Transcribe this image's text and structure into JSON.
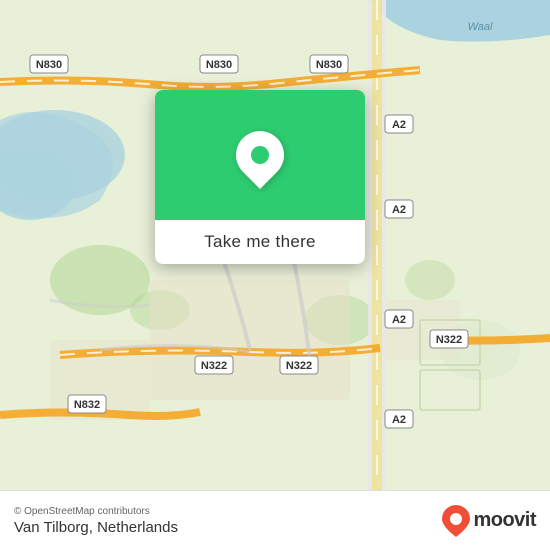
{
  "map": {
    "background_color": "#e8f0d8",
    "alt": "Map of Van Tilborg, Netherlands"
  },
  "popup": {
    "button_label": "Take me there",
    "pin_color": "#2ecc71",
    "pin_bg": "white"
  },
  "footer": {
    "credit": "© OpenStreetMap contributors",
    "location_name": "Van Tilborg, Netherlands",
    "logo_text": "moovit"
  },
  "road_labels": {
    "n830_tl": "N830",
    "n830_tr": "N830",
    "n830_tm": "N830",
    "a2_r1": "A2",
    "a2_r2": "A2",
    "a2_r3": "A2",
    "a2_bot": "A2",
    "n322_l": "N322",
    "n322_m": "N322",
    "n322_r": "N322",
    "n832": "N832",
    "waal": "Waal"
  }
}
